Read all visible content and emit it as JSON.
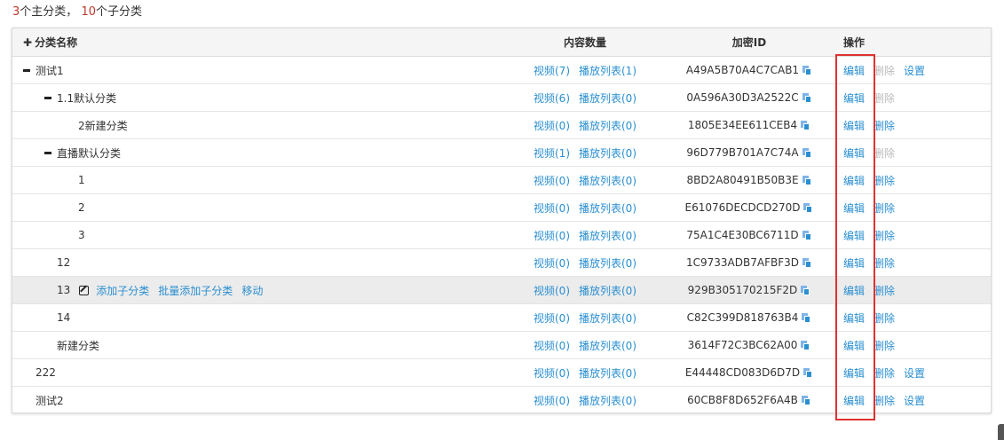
{
  "summary": {
    "main_count": "3",
    "main_suffix": "个主分类，",
    "sub_count": "10",
    "sub_suffix": "个子分类"
  },
  "header": {
    "name": "分类名称",
    "count": "内容数量",
    "id": "加密ID",
    "ops": "操作"
  },
  "icons": {
    "collapse": "minus-icon",
    "expand_all": "plus-icon",
    "copy": "copy-icon",
    "edit": "edit-icon"
  },
  "colors": {
    "link": "#2a8fd1",
    "disabled": "#bbbbbb",
    "highlight": "#e03131",
    "count_red": "#c0392b"
  },
  "rows": [
    {
      "name": "测试1",
      "video": "视频(7)",
      "playlist": "播放列表(1)",
      "id": "A49A5B70A4C7CAB1",
      "edit": "编辑",
      "delete": "删除",
      "settings": "设置"
    },
    {
      "name": "1.1默认分类",
      "video": "视频(6)",
      "playlist": "播放列表(0)",
      "id": "0A596A30D3A2522C",
      "edit": "编辑",
      "delete": "删除"
    },
    {
      "name": "2新建分类",
      "video": "视频(0)",
      "playlist": "播放列表(0)",
      "id": "1805E34EE611CEB4",
      "edit": "编辑",
      "delete": "删除"
    },
    {
      "name": "直播默认分类",
      "video": "视频(1)",
      "playlist": "播放列表(0)",
      "id": "96D779B701A7C74A",
      "edit": "编辑",
      "delete": "删除"
    },
    {
      "name": "1",
      "video": "视频(0)",
      "playlist": "播放列表(0)",
      "id": "8BD2A80491B50B3E",
      "edit": "编辑",
      "delete": "删除"
    },
    {
      "name": "2",
      "video": "视频(0)",
      "playlist": "播放列表(0)",
      "id": "E61076DECDCD270D",
      "edit": "编辑",
      "delete": "删除"
    },
    {
      "name": "3",
      "video": "视频(0)",
      "playlist": "播放列表(0)",
      "id": "75A1C4E30BC6711D",
      "edit": "编辑",
      "delete": "删除"
    },
    {
      "name": "12",
      "video": "视频(0)",
      "playlist": "播放列表(0)",
      "id": "1C9733ADB7AFBF3D",
      "edit": "编辑",
      "delete": "删除"
    },
    {
      "name": "13",
      "add_sub": "添加子分类",
      "batch_add": "批量添加子分类",
      "move": "移动",
      "video": "视频(0)",
      "playlist": "播放列表(0)",
      "id": "929B305170215F2D",
      "edit": "编辑",
      "delete": "删除"
    },
    {
      "name": "14",
      "video": "视频(0)",
      "playlist": "播放列表(0)",
      "id": "C82C399D818763B4",
      "edit": "编辑",
      "delete": "删除"
    },
    {
      "name": "新建分类",
      "video": "视频(0)",
      "playlist": "播放列表(0)",
      "id": "3614F72C3BC62A00",
      "edit": "编辑",
      "delete": "删除"
    },
    {
      "name": "222",
      "video": "视频(0)",
      "playlist": "播放列表(0)",
      "id": "E44448CD083D6D7D",
      "edit": "编辑",
      "delete": "删除",
      "settings": "设置"
    },
    {
      "name": "测试2",
      "video": "视频(0)",
      "playlist": "播放列表(0)",
      "id": "60CB8F8D652F6A4B",
      "edit": "编辑",
      "delete": "删除",
      "settings": "设置"
    }
  ]
}
